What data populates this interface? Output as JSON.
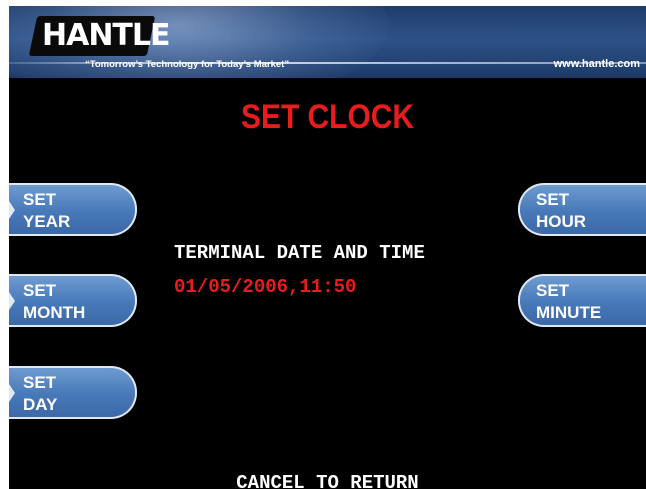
{
  "header": {
    "logo_text": "HANTLE",
    "tagline": "“Tomorrow’s Technology for Today’s Market”",
    "website": "www.hantle.com"
  },
  "screen": {
    "title": "SET CLOCK",
    "datetime_label": "TERMINAL DATE AND TIME",
    "datetime_value": "01/05/2006,11:50",
    "footer_prompt": "CANCEL TO RETURN"
  },
  "buttons": {
    "set_year": {
      "line1": "SET",
      "line2": "YEAR"
    },
    "set_month": {
      "line1": "SET",
      "line2": "MONTH"
    },
    "set_day": {
      "line1": "SET",
      "line2": "DAY"
    },
    "set_hour": {
      "line1": "SET",
      "line2": "HOUR"
    },
    "set_minute": {
      "line1": "SET",
      "line2": "MINUTE"
    }
  },
  "colors": {
    "background": "#000000",
    "title_red": "#e81c1c",
    "button_blue": "#4778b8",
    "header_blue": "#2c5288"
  }
}
